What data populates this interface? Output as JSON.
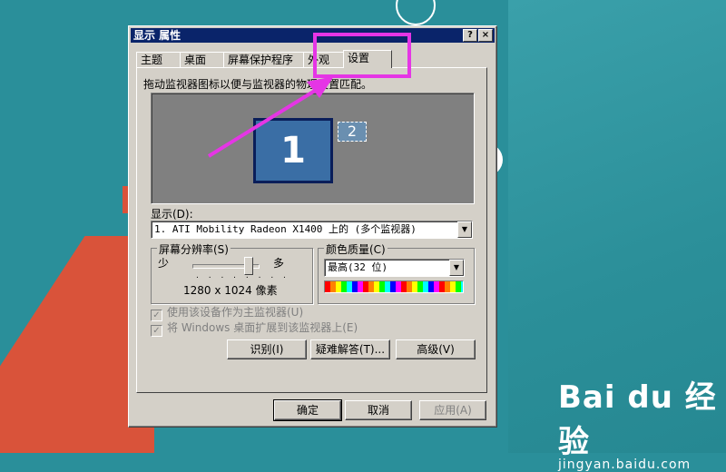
{
  "window": {
    "title": "显示 属性",
    "help_btn": "?",
    "close_btn": "×"
  },
  "tabs": [
    {
      "label": "主题"
    },
    {
      "label": "桌面"
    },
    {
      "label": "屏幕保护程序"
    },
    {
      "label": "外观"
    },
    {
      "label": "设置"
    }
  ],
  "settings": {
    "instruction": "拖动监视器图标以便与监视器的物理设置匹配。",
    "monitor1": "1",
    "monitor2": "2",
    "display_label": "显示(D):",
    "display_value": "1. ATI Mobility Radeon X1400 上的 (多个监视器)",
    "resolution": {
      "group_title": "屏幕分辨率(S)",
      "less": "少",
      "more": "多",
      "ticks": ". . . . . . . .",
      "value": "1280 x 1024 像素",
      "slider_level_percent": 85
    },
    "color_quality": {
      "group_title": "颜色质量(C)",
      "value": "最高(32 位)"
    },
    "checkbox_primary": "使用该设备作为主监视器(U)",
    "checkbox_extend": "将 Windows 桌面扩展到该监视器上(E)",
    "identify_btn": "识别(I)",
    "troubleshoot_btn": "疑难解答(T)...",
    "advanced_btn": "高级(V)"
  },
  "footer": {
    "ok": "确定",
    "cancel": "取消",
    "apply": "应用(A)"
  },
  "watermark": {
    "logo": "Bai du 经验",
    "url": "jingyan.baidu.com"
  },
  "colors": {
    "highlight": "#e535e5",
    "titlebar": "#0a246a",
    "desktop": "#2a8f9a"
  }
}
